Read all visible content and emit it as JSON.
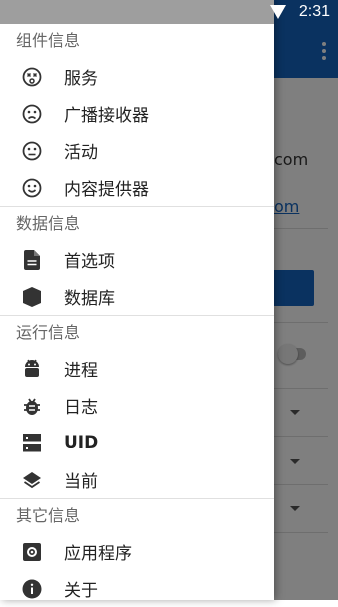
{
  "status_bar": {
    "time": "2:31"
  },
  "background": {
    "text_partial_1": "com",
    "text_partial_2": "om"
  },
  "drawer": {
    "sections": [
      {
        "header": "组件信息",
        "items": [
          {
            "label": "服务",
            "icon": "face-dizzy-icon"
          },
          {
            "label": "广播接收器",
            "icon": "face-sad-icon"
          },
          {
            "label": "活动",
            "icon": "face-neutral-icon"
          },
          {
            "label": "内容提供器",
            "icon": "face-smile-icon"
          }
        ]
      },
      {
        "header": "数据信息",
        "items": [
          {
            "label": "首选项",
            "icon": "file-icon"
          },
          {
            "label": "数据库",
            "icon": "database-icon"
          }
        ]
      },
      {
        "header": "运行信息",
        "items": [
          {
            "label": "进程",
            "icon": "android-icon"
          },
          {
            "label": "日志",
            "icon": "bug-icon"
          },
          {
            "label": "UID",
            "icon": "server-icon"
          },
          {
            "label": "当前",
            "icon": "layers-icon"
          }
        ]
      },
      {
        "header": "其它信息",
        "items": [
          {
            "label": "应用程序",
            "icon": "settings-box-icon"
          },
          {
            "label": "关于",
            "icon": "info-icon"
          }
        ]
      }
    ]
  },
  "colors": {
    "primary": "#1565c0",
    "icon": "#333333"
  }
}
